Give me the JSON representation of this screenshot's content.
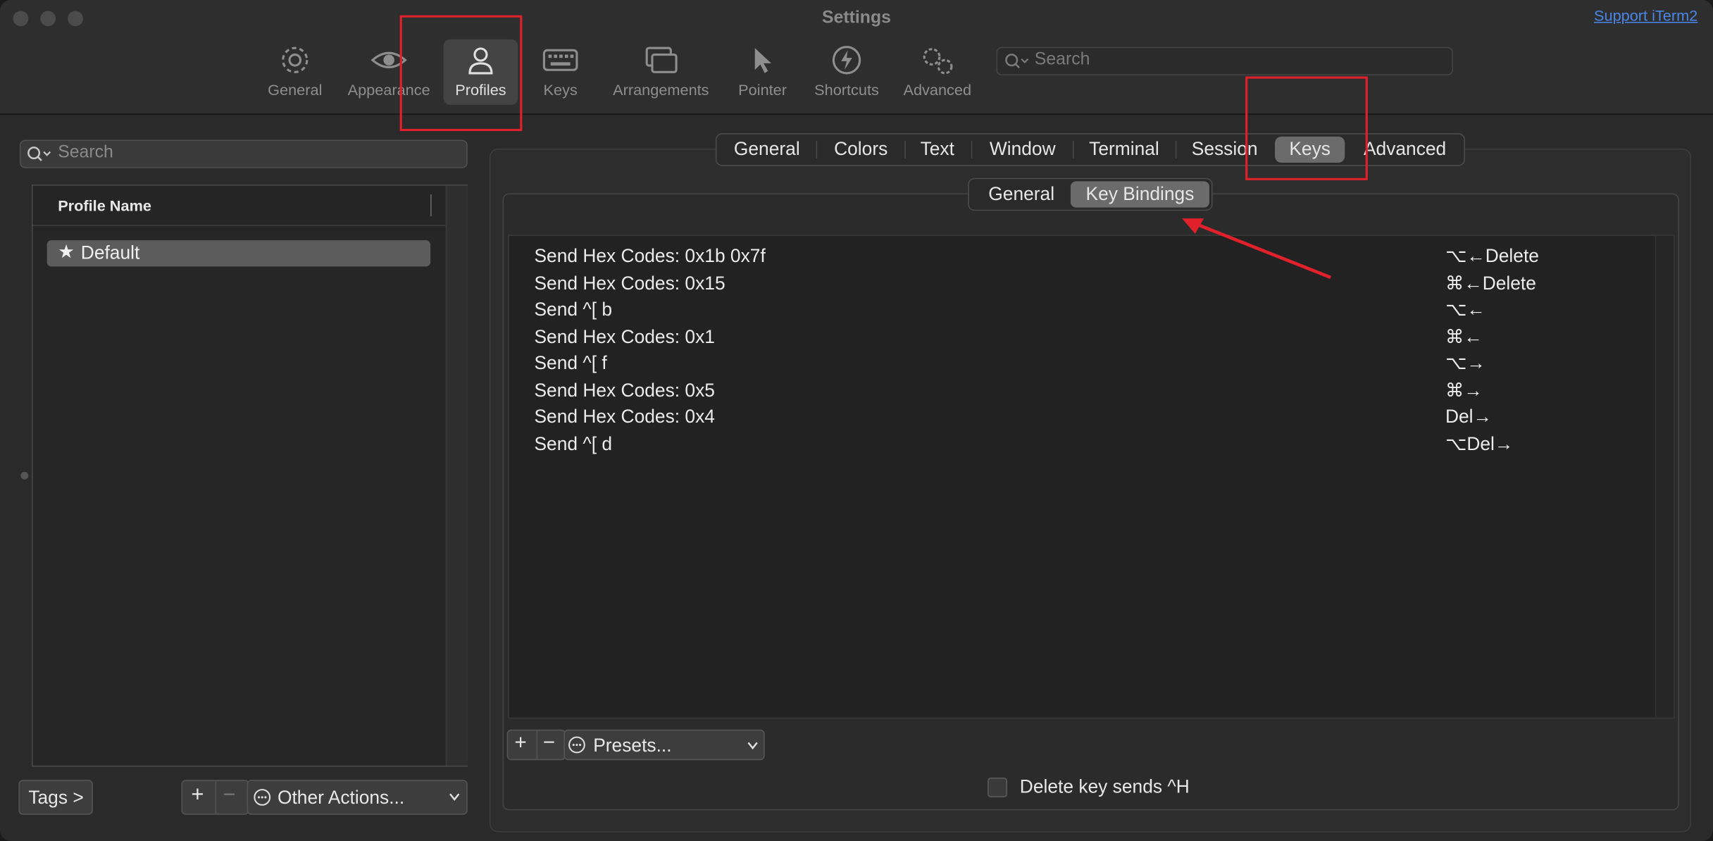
{
  "window": {
    "title": "Settings",
    "support_link": "Support iTerm2"
  },
  "toolbar": {
    "items": [
      {
        "label": "General",
        "icon": "gear-icon"
      },
      {
        "label": "Appearance",
        "icon": "eye-icon"
      },
      {
        "label": "Profiles",
        "icon": "person-icon",
        "active": true
      },
      {
        "label": "Keys",
        "icon": "keyboard-icon"
      },
      {
        "label": "Arrangements",
        "icon": "windows-icon"
      },
      {
        "label": "Pointer",
        "icon": "pointer-icon"
      },
      {
        "label": "Shortcuts",
        "icon": "bolt-icon"
      },
      {
        "label": "Advanced",
        "icon": "gears-icon"
      }
    ],
    "search_placeholder": "Search"
  },
  "left_pane": {
    "search_placeholder": "Search",
    "column_header": "Profile Name",
    "profiles": [
      {
        "name": "Default",
        "starred": true,
        "selected": true
      }
    ],
    "tags_button": "Tags >",
    "other_actions": "Other Actions..."
  },
  "main_tabs": {
    "items": [
      "General",
      "Colors",
      "Text",
      "Window",
      "Terminal",
      "Session",
      "Keys",
      "Advanced"
    ],
    "active": "Keys"
  },
  "sub_tabs": {
    "items": [
      "General",
      "Key Bindings"
    ],
    "active": "Key Bindings"
  },
  "key_bindings": [
    {
      "action": "Send Hex Codes: 0x1b 0x7f",
      "key": "⌥←Delete"
    },
    {
      "action": "Send Hex Codes: 0x15",
      "key": "⌘←Delete"
    },
    {
      "action": "Send ^[ b",
      "key": "⌥←"
    },
    {
      "action": "Send Hex Codes: 0x1",
      "key": "⌘←"
    },
    {
      "action": "Send ^[ f",
      "key": "⌥→"
    },
    {
      "action": "Send Hex Codes: 0x5",
      "key": "⌘→"
    },
    {
      "action": "Send Hex Codes: 0x4",
      "key": "Del→"
    },
    {
      "action": "Send ^[ d",
      "key": "⌥Del→"
    }
  ],
  "bindings_controls": {
    "plus": "+",
    "minus": "−",
    "presets": "Presets..."
  },
  "options": {
    "delete_sends_ctrl_h": {
      "label": "Delete key sends ^H",
      "checked": false
    }
  },
  "colors": {
    "annotation_red": "#e0202a",
    "link_blue": "#4a86e8"
  }
}
